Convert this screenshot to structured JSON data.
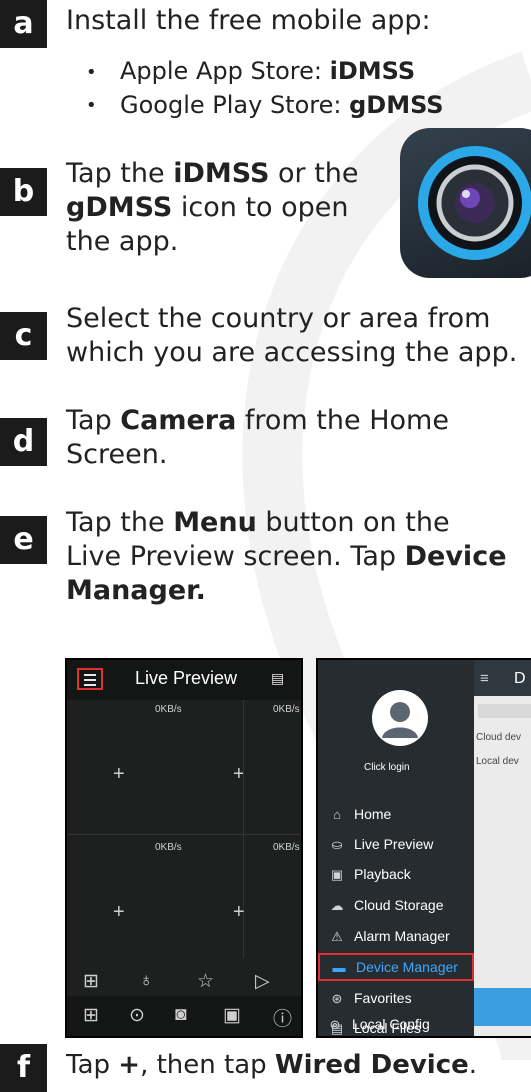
{
  "steps": {
    "a": {
      "letter": "a",
      "text": "Install the free mobile app:",
      "stores": [
        {
          "prefix": "Apple App Store: ",
          "name": "iDMSS"
        },
        {
          "prefix": "Google Play Store: ",
          "name": "gDMSS"
        }
      ]
    },
    "b": {
      "letter": "b",
      "pre": "Tap the ",
      "bold1": "iDMSS",
      "mid": " or the",
      "bold2": "gDMSS",
      "post": " icon to open",
      "line3": "the app."
    },
    "c": {
      "letter": "c",
      "line1": "Select the country or area from",
      "line2": "which you are accessing the app."
    },
    "d": {
      "letter": "d",
      "pre": "Tap ",
      "bold": "Camera",
      "post": " from the Home",
      "line2": "Screen."
    },
    "e": {
      "letter": "e",
      "pre": "Tap the ",
      "bold1": "Menu",
      "post1": " button on the",
      "line2pre": "Live Preview screen. Tap ",
      "bold2": "Device",
      "bold3": "Manager."
    },
    "f": {
      "letter": "f",
      "pre": "Tap ",
      "bold1": "+",
      "mid": ", then tap ",
      "bold2": "Wired Device",
      "post": "."
    }
  },
  "live_preview": {
    "title": "Live Preview",
    "rates": [
      "0KB/s",
      "0KB/s",
      "0KB/s",
      "0KB/s"
    ],
    "icons": [
      "menu-icon",
      "multi-screen-icon",
      "grid-icon",
      "microphone-icon",
      "star-icon",
      "play-icon",
      "layout-icon",
      "snapshot-icon",
      "record-icon",
      "screen-icon",
      "info-icon"
    ]
  },
  "device_menu": {
    "login": "Click login",
    "right_title": "D",
    "right_lines": [
      "Cloud dev",
      "Local dev"
    ],
    "items": [
      {
        "label": "Home",
        "icon": "home-icon",
        "active": false
      },
      {
        "label": "Live Preview",
        "icon": "live-preview-icon",
        "active": false
      },
      {
        "label": "Playback",
        "icon": "playback-icon",
        "active": false
      },
      {
        "label": "Cloud Storage",
        "icon": "cloud-storage-icon",
        "active": false
      },
      {
        "label": "Alarm Manager",
        "icon": "alarm-icon",
        "active": false
      },
      {
        "label": "Device Manager",
        "icon": "device-manager-icon",
        "active": true
      },
      {
        "label": "Favorites",
        "icon": "favorites-icon",
        "active": false
      },
      {
        "label": "Local Files",
        "icon": "local-files-icon",
        "active": false
      },
      {
        "label": "Local Config",
        "icon": "local-config-icon",
        "active": false
      }
    ]
  },
  "colors": {
    "step_badge": "#1b1b1b",
    "highlight": "#e03030",
    "active_blue": "#3ea8ff"
  }
}
